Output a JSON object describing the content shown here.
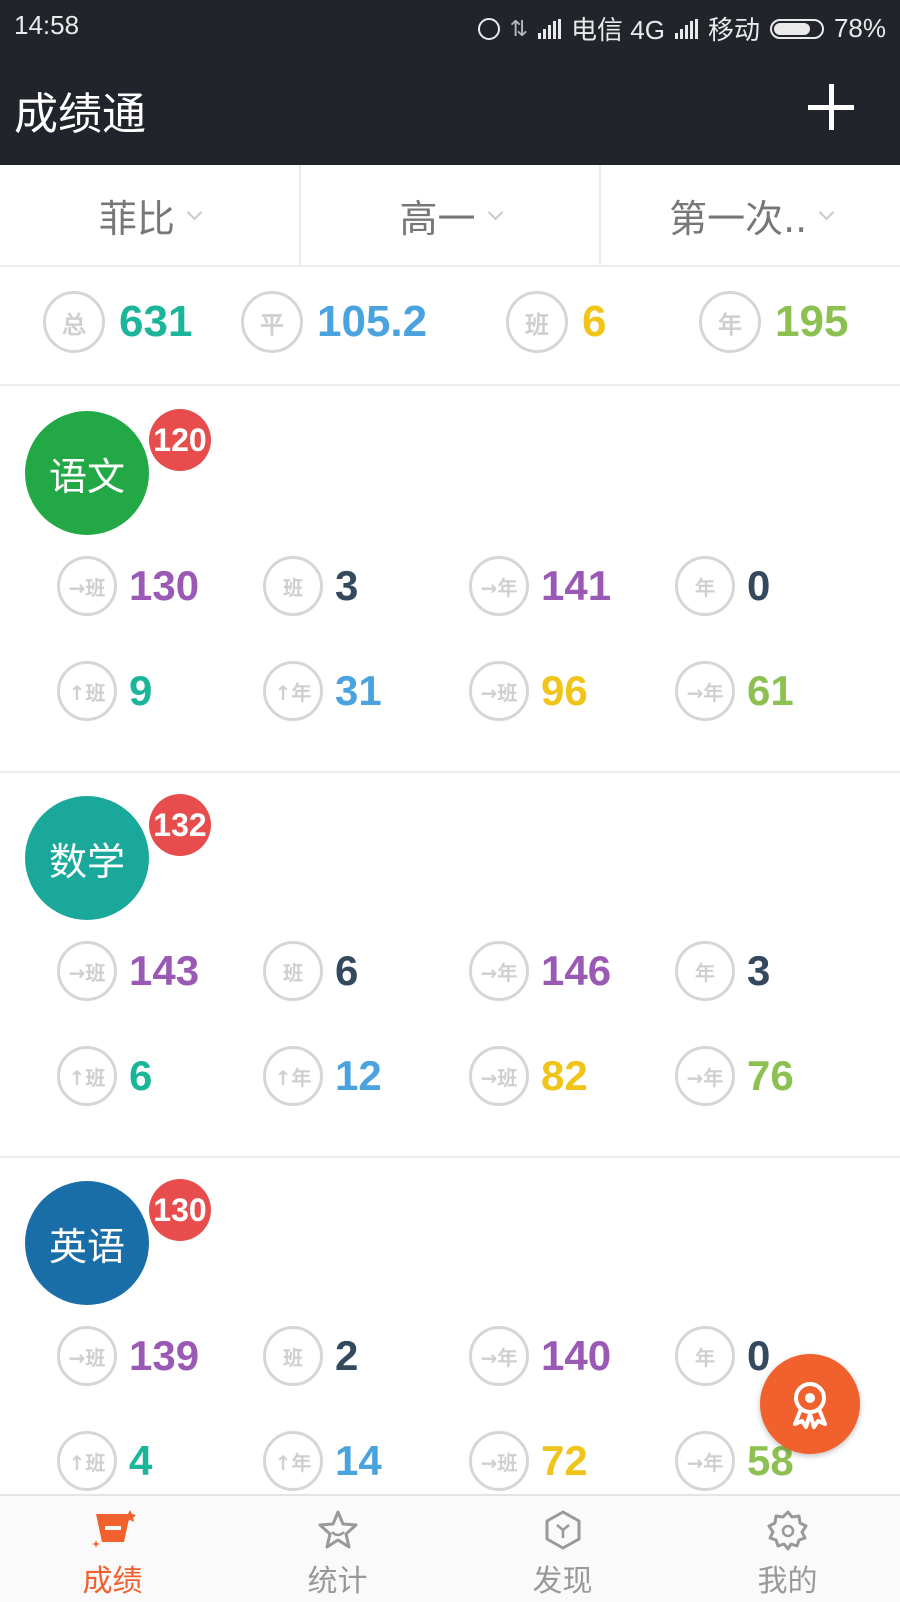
{
  "status_bar": {
    "time": "14:58",
    "carrier1": "电信 4G",
    "carrier2": "移动",
    "battery": "78%",
    "battery_level": 0.78
  },
  "app": {
    "title": "成绩通",
    "add_icon": "plus-icon"
  },
  "filters": [
    {
      "label": "菲比"
    },
    {
      "label": "高一"
    },
    {
      "label": "第一次.."
    }
  ],
  "summary": [
    {
      "badge": "总",
      "value": "631",
      "color": "#1bb59a"
    },
    {
      "badge": "平",
      "value": "105.2",
      "color": "#4aa3df"
    },
    {
      "badge": "班",
      "value": "6",
      "color": "#f0c419"
    },
    {
      "badge": "年",
      "value": "195",
      "color": "#8cc152"
    }
  ],
  "badge_glyphs": [
    "班",
    "班",
    "年",
    "年",
    "班",
    "年",
    "班",
    "年"
  ],
  "stat_colors": [
    "#9b59b6",
    "#34495e",
    "#9b59b6",
    "#34495e",
    "#1bb59a",
    "#4aa3df",
    "#f0c419",
    "#8cc152"
  ],
  "subjects": [
    {
      "name": "语文",
      "score": "120",
      "color": "#22a845",
      "stats": [
        "130",
        "3",
        "141",
        "0",
        "9",
        "31",
        "96",
        "61"
      ]
    },
    {
      "name": "数学",
      "score": "132",
      "color": "#1aa89a",
      "stats": [
        "143",
        "6",
        "146",
        "3",
        "6",
        "12",
        "82",
        "76"
      ]
    },
    {
      "name": "英语",
      "score": "130",
      "color": "#1a6ea8",
      "stats": [
        "139",
        "2",
        "140",
        "0",
        "4",
        "14",
        "72",
        "58"
      ]
    }
  ],
  "nav": [
    {
      "label": "成绩",
      "icon": "grade-icon",
      "active": true
    },
    {
      "label": "统计",
      "icon": "star-icon",
      "active": false
    },
    {
      "label": "发现",
      "icon": "discover-icon",
      "active": false
    },
    {
      "label": "我的",
      "icon": "settings-icon",
      "active": false
    }
  ],
  "fab_icon": "award-icon",
  "colors": {
    "bar": "#21242b",
    "accent": "#f0612d",
    "nav_inactive": "#999999"
  }
}
